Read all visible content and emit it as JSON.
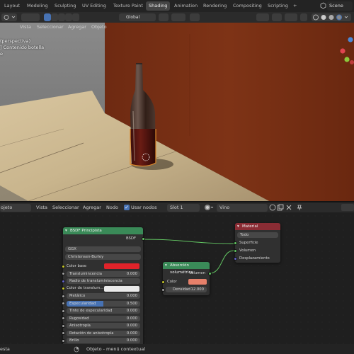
{
  "workspace_tabs": [
    "Layout",
    "Modeling",
    "Sculpting",
    "UV Editing",
    "Texture Paint",
    "Shading",
    "Animation",
    "Rendering",
    "Compositing",
    "Scripting",
    "+"
  ],
  "active_tab": "Shading",
  "scene_name": "Scene",
  "viewport": {
    "transform_orientation": "Global",
    "menu": [
      "Vista",
      "Seleccionar",
      "Agregar",
      "Objeto"
    ],
    "overlay_lines": [
      "(perspectiva)",
      "] Contenido botella",
      "e"
    ]
  },
  "node_editor": {
    "object_label": "ojeto",
    "menu": [
      "Vista",
      "Seleccionar",
      "Agregar",
      "Nodo"
    ],
    "use_nodes_label": "Usar nodos",
    "slot": "Slot 1",
    "material_name": "Vino",
    "bsdf": {
      "title": "BSDF Principista",
      "output": "BSDF",
      "distribution": "GGX",
      "subsurface_method": "Christensen-Burley",
      "rows": [
        {
          "label": "Color base",
          "kind": "color",
          "color": "#e0232a"
        },
        {
          "label": "Translumincencia",
          "value": "0.000"
        },
        {
          "label": "Radio de transluminiscencia",
          "kind": "dropdown"
        },
        {
          "label": "Color de translum...",
          "kind": "color",
          "color": "#eaeaea"
        },
        {
          "label": "Metálico",
          "value": "0.000"
        },
        {
          "label": "Especularidad",
          "value": "0.500",
          "highlight": true
        },
        {
          "label": "Tinte de especularidad",
          "value": "0.000"
        },
        {
          "label": "Rugosidad",
          "value": "0.000"
        },
        {
          "label": "Anisotropía",
          "value": "0.000"
        },
        {
          "label": "Rotación de anisotropía",
          "value": "0.000"
        },
        {
          "label": "Brillo",
          "value": "0.000"
        }
      ]
    },
    "absorption": {
      "title": "Absorción volumétrica",
      "output": "Volumen",
      "color_label": "Color",
      "color": "#e6806a",
      "density_label": "Densidad",
      "density": "12.000"
    },
    "material_output": {
      "title": "Material",
      "target": "Todo",
      "inputs": [
        "Superficie",
        "Volumen",
        "Desplazamiento"
      ]
    }
  },
  "status": {
    "left": "esta",
    "context": "Objeto - menú contextual"
  }
}
